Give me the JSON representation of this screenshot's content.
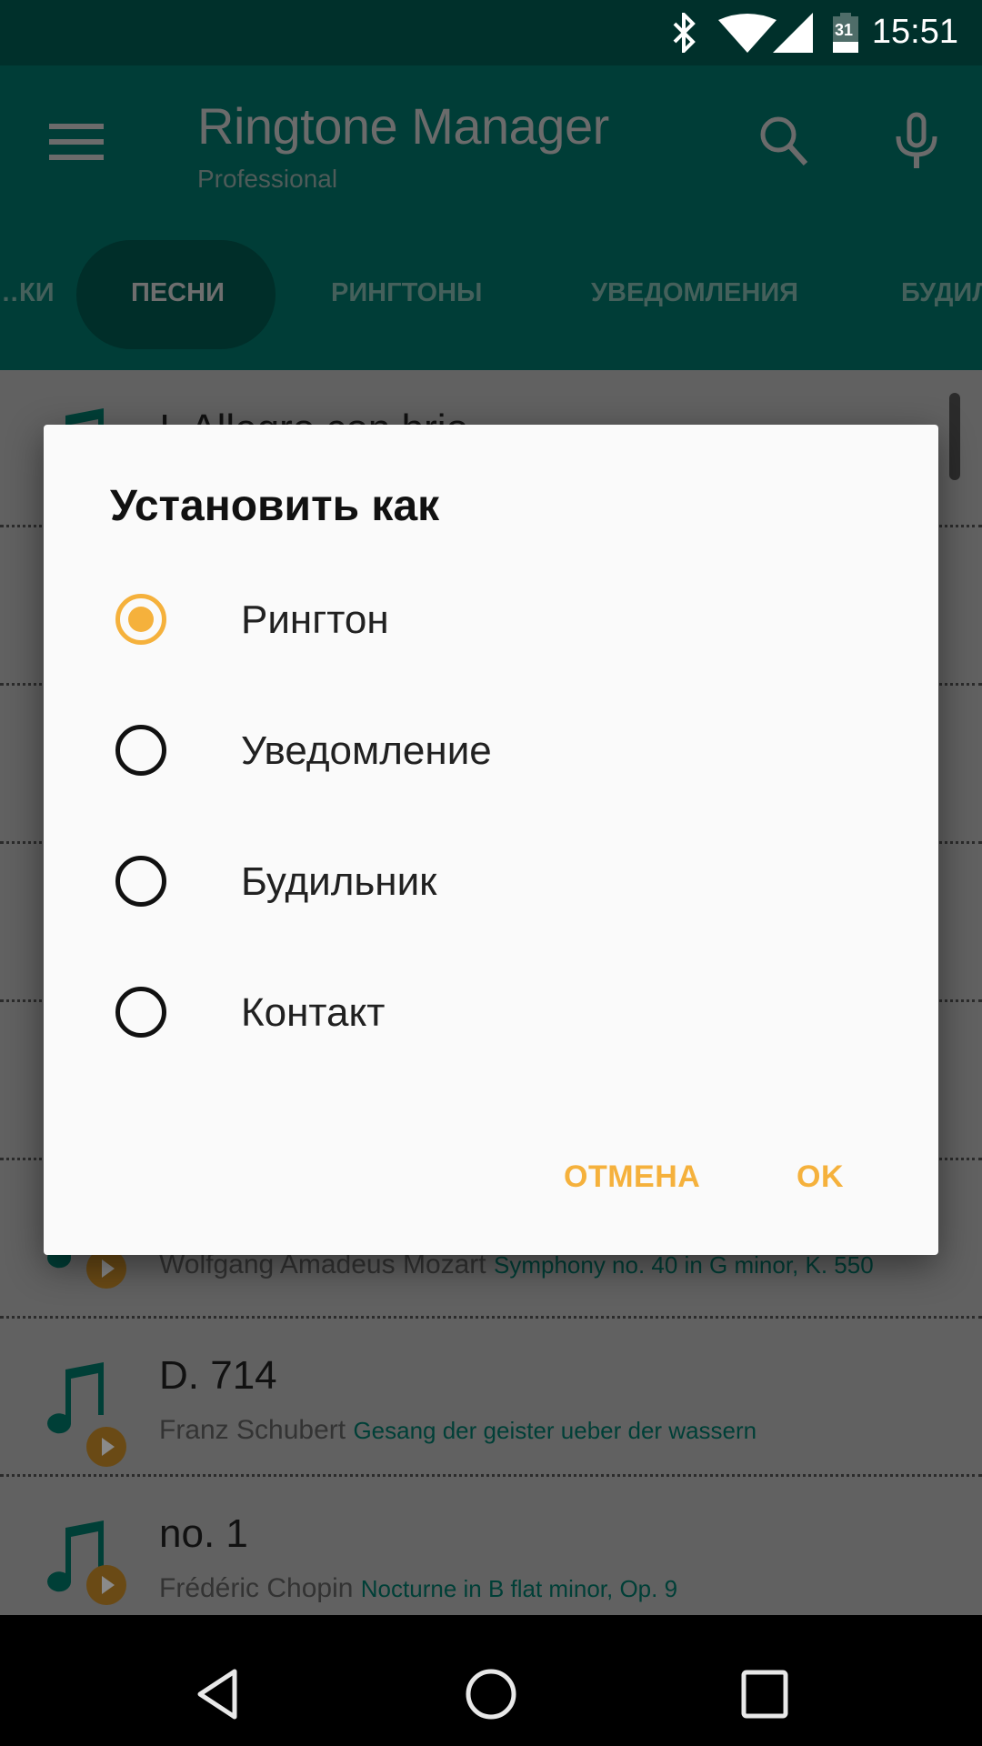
{
  "status_bar": {
    "time": "15:51",
    "icons": [
      "bluetooth-icon",
      "wifi-icon",
      "signal-icon",
      "battery-icon"
    ],
    "battery_level": "31"
  },
  "app_bar": {
    "title": "Ringtone Manager",
    "subtitle": "Professional",
    "menu_icon": "hamburger-icon",
    "actions": [
      "search-icon",
      "mic-icon"
    ]
  },
  "tabs": [
    {
      "label": "…ки",
      "active": false
    },
    {
      "label": "Песни",
      "active": true
    },
    {
      "label": "Рингтоны",
      "active": false
    },
    {
      "label": "Уведомления",
      "active": false
    },
    {
      "label": "Будил…",
      "active": false
    }
  ],
  "songs": [
    {
      "title": "I. Allegro con brio",
      "artist": "",
      "work": ""
    },
    {
      "title": "",
      "artist": "Wolfgang Amadeus Mozart",
      "work": "Symphony no. 40 in G minor, K. 550"
    },
    {
      "title": "D. 714",
      "artist": "Franz Schubert",
      "work": "Gesang der geister ueber der wassern"
    },
    {
      "title": "no. 1",
      "artist": "Frédéric Chopin",
      "work": "Nocturne in B flat minor, Op. 9"
    }
  ],
  "dialog": {
    "title": "Установить как",
    "options": [
      {
        "label": "Рингтон",
        "checked": true
      },
      {
        "label": "Уведомление",
        "checked": false
      },
      {
        "label": "Будильник",
        "checked": false
      },
      {
        "label": "Контакт",
        "checked": false
      }
    ],
    "cancel_label": "ОТМЕНА",
    "ok_label": "OK"
  },
  "colors": {
    "accent": "#f5b13c",
    "primary_dimmed": "#003d37",
    "scrim": "#616161"
  },
  "nav_bar": [
    "back-icon",
    "home-icon",
    "recents-icon"
  ]
}
